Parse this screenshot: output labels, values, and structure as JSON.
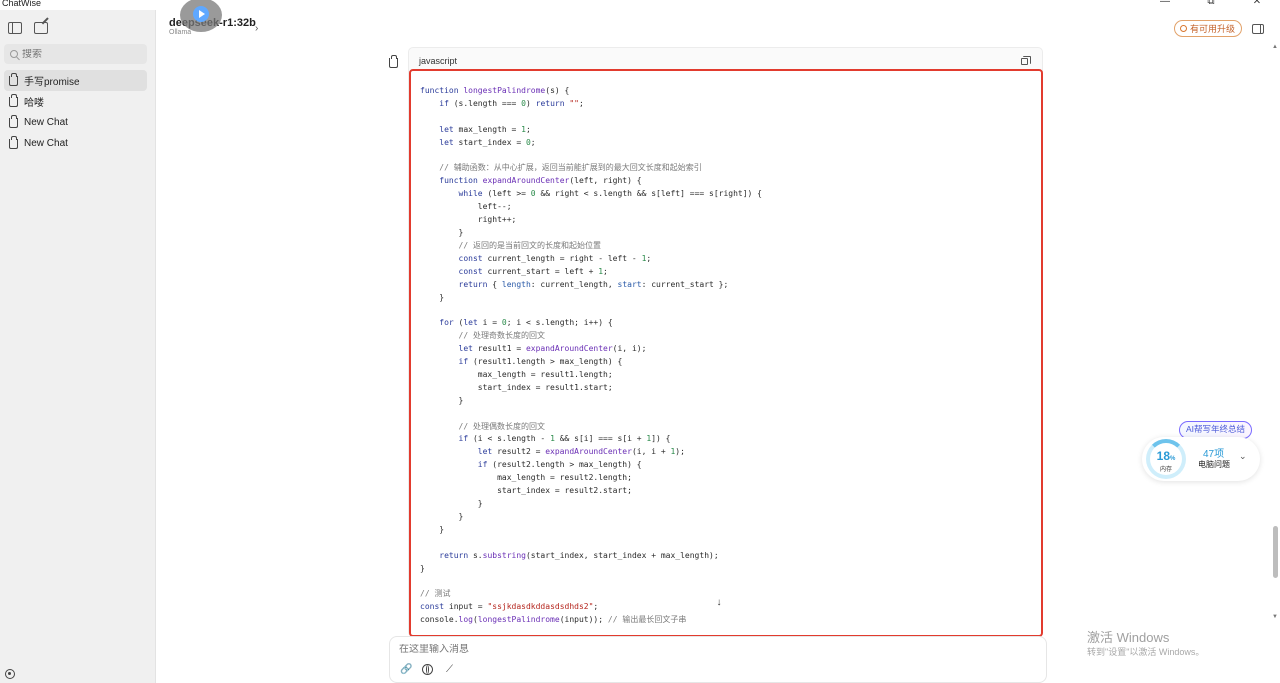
{
  "window": {
    "title": "ChatWise",
    "minimize": "—",
    "maximize": "⧉",
    "close": "✕"
  },
  "sidebar": {
    "search_placeholder": "搜索",
    "chats": [
      {
        "label": "手写promise"
      },
      {
        "label": "哈喽"
      },
      {
        "label": "New Chat"
      },
      {
        "label": "New Chat"
      }
    ]
  },
  "header": {
    "model": "deepseek-r1:32b",
    "provider": "Ollama",
    "chevron": "›",
    "upgrade_label": "有可用升级"
  },
  "message": {
    "language": "javascript",
    "scroll_down": "↓"
  },
  "composer": {
    "placeholder": "在这里输入消息",
    "attach": "🔗",
    "send_glyph": "⟋"
  },
  "widget": {
    "tag": "AI帮写年终总结",
    "memory_percent": "18",
    "memory_unit": "%",
    "memory_label": "内存",
    "issue_count": "47项",
    "issue_label": "电脑问题",
    "chevron": "⌄"
  },
  "watermark": {
    "title": "激活 Windows",
    "subtitle": "转到\"设置\"以激活 Windows。"
  },
  "scrollbar": {
    "up": "▲",
    "down": "▼"
  }
}
